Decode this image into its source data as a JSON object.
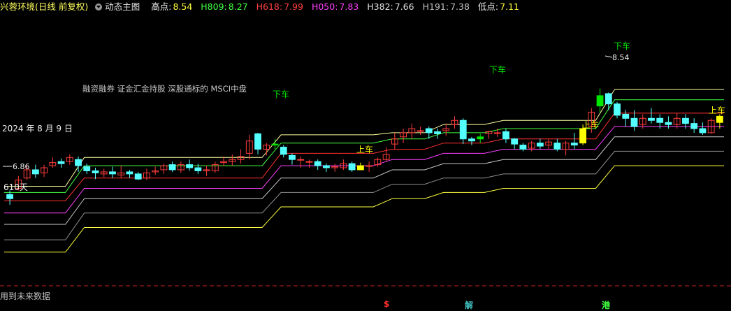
{
  "header": {
    "title": "兴蓉环境(日线 前复权)",
    "indicator_name": "动态主图",
    "items": [
      {
        "label": "高点:",
        "value": "8.54",
        "color": "#f0f0f0",
        "vcolor": "#ffff40"
      },
      {
        "label": "H809:",
        "value": "8.27",
        "color": "#40ff40",
        "vcolor": "#40ff40"
      },
      {
        "label": "H618:",
        "value": "7.99",
        "color": "#ff4040",
        "vcolor": "#ff4040"
      },
      {
        "label": "H050:",
        "value": "7.83",
        "color": "#ff40ff",
        "vcolor": "#ff40ff"
      },
      {
        "label": "H382:",
        "value": "7.66",
        "color": "#e0e0e0",
        "vcolor": "#e0e0e0"
      },
      {
        "label": "H191:",
        "value": "7.38",
        "color": "#c0c0c0",
        "vcolor": "#c0c0c0"
      },
      {
        "label": "低点:",
        "value": "7.11",
        "color": "#f0f0f0",
        "vcolor": "#ffff40"
      }
    ]
  },
  "footer": {
    "note": "用到未来数据",
    "markers": [
      {
        "text": "$",
        "color": "#ff3030"
      },
      {
        "text": "解",
        "color": "#40c0c0"
      },
      {
        "text": "港",
        "color": "#40ff40"
      }
    ]
  },
  "chart_data": {
    "type": "candlestick",
    "annotations": {
      "date_label": "2024 年 8 月 9 日",
      "concept_text": "融资融券 证金汇金持股 深股通标的 MSCI中盘",
      "low_value": "6.86",
      "high_value": "8.54",
      "days_label": "610天",
      "sell_label": "下车",
      "buy_label": "上车"
    },
    "colors": {
      "up": "#ff3c3c",
      "down": "#54ffff",
      "buy_signal": "#ffff00",
      "sell_signal": "#00e600",
      "bands": [
        "#ffffa0",
        "#40ff40",
        "#ff3030",
        "#ff40ff",
        "#c8c8c8",
        "#909090",
        "#ffff40"
      ]
    },
    "candles": [
      [
        6.96,
        6.92,
        7.0,
        6.86
      ],
      [
        7.02,
        7.1,
        7.14,
        7.0
      ],
      [
        7.12,
        7.2,
        7.24,
        7.1
      ],
      [
        7.2,
        7.16,
        7.25,
        7.12
      ],
      [
        7.17,
        7.22,
        7.25,
        7.13
      ],
      [
        7.24,
        7.27,
        7.32,
        7.22
      ],
      [
        7.28,
        7.26,
        7.31,
        7.22
      ],
      [
        7.28,
        7.32,
        7.35,
        7.25
      ],
      [
        7.3,
        7.24,
        7.33,
        7.18
      ],
      [
        7.23,
        7.19,
        7.26,
        7.16
      ],
      [
        7.19,
        7.17,
        7.22,
        7.11
      ],
      [
        7.16,
        7.18,
        7.21,
        7.13
      ],
      [
        7.18,
        7.16,
        7.23,
        7.12
      ],
      [
        7.15,
        7.17,
        7.24,
        7.12
      ],
      [
        7.18,
        7.16,
        7.2,
        7.12
      ],
      [
        7.16,
        7.11,
        7.18,
        7.1
      ],
      [
        7.12,
        7.17,
        7.21,
        7.1
      ],
      [
        7.18,
        7.19,
        7.23,
        7.15
      ],
      [
        7.2,
        7.24,
        7.26,
        7.16
      ],
      [
        7.25,
        7.2,
        7.28,
        7.18
      ],
      [
        7.2,
        7.25,
        7.28,
        7.17
      ],
      [
        7.25,
        7.22,
        7.3,
        7.19
      ],
      [
        7.22,
        7.19,
        7.26,
        7.16
      ],
      [
        7.19,
        7.2,
        7.24,
        7.14
      ],
      [
        7.19,
        7.25,
        7.28,
        7.17
      ],
      [
        7.27,
        7.28,
        7.33,
        7.24
      ],
      [
        7.28,
        7.3,
        7.35,
        7.24
      ],
      [
        7.3,
        7.33,
        7.4,
        7.26
      ],
      [
        7.36,
        7.48,
        7.54,
        7.3
      ],
      [
        7.55,
        7.4,
        7.56,
        7.35
      ],
      [
        7.4,
        7.44,
        7.46,
        7.34
      ],
      [
        7.44,
        7.45,
        7.5,
        7.4
      ],
      [
        7.42,
        7.35,
        7.44,
        7.32
      ],
      [
        7.34,
        7.3,
        7.36,
        7.25
      ],
      [
        7.3,
        7.3,
        7.33,
        7.22
      ],
      [
        7.28,
        7.28,
        7.3,
        7.22
      ],
      [
        7.28,
        7.24,
        7.3,
        7.2
      ],
      [
        7.24,
        7.22,
        7.26,
        7.18
      ],
      [
        7.22,
        7.23,
        7.26,
        7.18
      ],
      [
        7.22,
        7.26,
        7.3,
        7.2
      ],
      [
        7.26,
        7.2,
        7.28,
        7.18
      ],
      [
        7.2,
        7.24,
        7.27,
        7.2
      ],
      [
        7.24,
        7.24,
        7.28,
        7.18
      ],
      [
        7.25,
        7.3,
        7.32,
        7.23
      ],
      [
        7.3,
        7.35,
        7.42,
        7.28
      ],
      [
        7.45,
        7.5,
        7.56,
        7.4
      ],
      [
        7.52,
        7.56,
        7.6,
        7.46
      ],
      [
        7.56,
        7.6,
        7.65,
        7.5
      ],
      [
        7.58,
        7.58,
        7.62,
        7.54
      ],
      [
        7.6,
        7.56,
        7.62,
        7.5
      ],
      [
        7.57,
        7.55,
        7.6,
        7.5
      ],
      [
        7.58,
        7.6,
        7.65,
        7.53
      ],
      [
        7.64,
        7.68,
        7.72,
        7.6
      ],
      [
        7.68,
        7.5,
        7.7,
        7.45
      ],
      [
        7.5,
        7.48,
        7.52,
        7.44
      ],
      [
        7.5,
        7.52,
        7.55,
        7.46
      ],
      [
        7.55,
        7.57,
        7.58,
        7.5
      ],
      [
        7.56,
        7.56,
        7.6,
        7.52
      ],
      [
        7.57,
        7.5,
        7.6,
        7.46
      ],
      [
        7.5,
        7.45,
        7.51,
        7.4
      ],
      [
        7.44,
        7.4,
        7.46,
        7.38
      ],
      [
        7.41,
        7.46,
        7.48,
        7.38
      ],
      [
        7.46,
        7.43,
        7.5,
        7.4
      ],
      [
        7.44,
        7.47,
        7.5,
        7.4
      ],
      [
        7.46,
        7.4,
        7.5,
        7.38
      ],
      [
        7.4,
        7.46,
        7.48,
        7.34
      ],
      [
        7.46,
        7.44,
        7.56,
        7.4
      ],
      [
        7.46,
        7.6,
        7.64,
        7.44
      ],
      [
        7.62,
        7.76,
        7.8,
        7.56
      ],
      [
        7.82,
        7.92,
        7.99,
        7.76
      ],
      [
        7.94,
        7.84,
        7.95,
        7.78
      ],
      [
        7.84,
        7.73,
        7.86,
        7.7
      ],
      [
        7.74,
        7.7,
        7.78,
        7.62
      ],
      [
        7.7,
        7.62,
        7.78,
        7.58
      ],
      [
        7.64,
        7.7,
        7.74,
        7.6
      ],
      [
        7.7,
        7.68,
        7.8,
        7.65
      ],
      [
        7.7,
        7.66,
        7.74,
        7.6
      ],
      [
        7.66,
        7.64,
        7.72,
        7.6
      ],
      [
        7.64,
        7.7,
        7.75,
        7.6
      ],
      [
        7.7,
        7.65,
        7.74,
        7.6
      ],
      [
        7.65,
        7.6,
        7.7,
        7.56
      ],
      [
        7.6,
        7.56,
        7.66,
        7.54
      ],
      [
        7.56,
        7.68,
        7.7,
        7.55
      ],
      [
        7.66,
        7.72,
        7.74,
        7.6
      ]
    ],
    "signals": {
      "buy_yellow": [
        41,
        67,
        83
      ],
      "sell_green": [
        31,
        55,
        69
      ]
    },
    "bands": [
      {
        "name": "高点",
        "stairs": [
          [
            0,
            7.04
          ],
          [
            7,
            7.32
          ],
          [
            30,
            7.54
          ],
          [
            43,
            7.56
          ],
          [
            49,
            7.64
          ],
          [
            56,
            7.68
          ],
          [
            69,
            7.98
          ]
        ]
      },
      {
        "name": "H809",
        "stairs": [
          [
            0,
            6.98
          ],
          [
            7,
            7.24
          ],
          [
            30,
            7.46
          ],
          [
            43,
            7.5
          ],
          [
            49,
            7.56
          ],
          [
            56,
            7.6
          ],
          [
            69,
            7.88
          ]
        ]
      },
      {
        "name": "H618",
        "stairs": [
          [
            0,
            6.9
          ],
          [
            7,
            7.12
          ],
          [
            30,
            7.36
          ],
          [
            43,
            7.4
          ],
          [
            49,
            7.46
          ],
          [
            56,
            7.5
          ],
          [
            69,
            7.75
          ]
        ]
      },
      {
        "name": "H050",
        "stairs": [
          [
            0,
            6.78
          ],
          [
            7,
            7.02
          ],
          [
            30,
            7.24
          ],
          [
            43,
            7.3
          ],
          [
            49,
            7.36
          ],
          [
            56,
            7.4
          ],
          [
            69,
            7.62
          ]
        ]
      },
      {
        "name": "H382",
        "stairs": [
          [
            0,
            6.67
          ],
          [
            7,
            6.92
          ],
          [
            30,
            7.12
          ],
          [
            43,
            7.2
          ],
          [
            49,
            7.26
          ],
          [
            56,
            7.3
          ],
          [
            69,
            7.52
          ]
        ]
      },
      {
        "name": "H191",
        "stairs": [
          [
            0,
            6.52
          ],
          [
            7,
            6.78
          ],
          [
            30,
            6.98
          ],
          [
            43,
            7.06
          ],
          [
            49,
            7.12
          ],
          [
            56,
            7.16
          ],
          [
            69,
            7.38
          ]
        ]
      },
      {
        "name": "低点",
        "stairs": [
          [
            0,
            6.4
          ],
          [
            7,
            6.64
          ],
          [
            30,
            6.84
          ],
          [
            43,
            6.92
          ],
          [
            49,
            6.98
          ],
          [
            56,
            7.02
          ],
          [
            69,
            7.24
          ]
        ]
      }
    ],
    "ylim": [
      6.1,
      8.7
    ]
  }
}
